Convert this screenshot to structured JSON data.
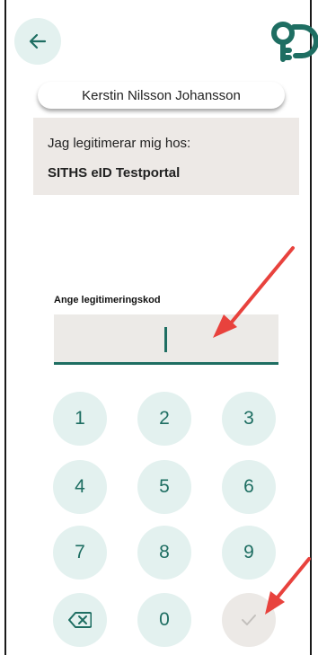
{
  "header": {
    "back_icon": "arrow-left-icon",
    "logo_icon": "key-logo-icon",
    "accent_color": "#1e6e62",
    "key_background": "#e3f1ef"
  },
  "user": {
    "name": "Kerstin Nilsson Johansson"
  },
  "info": {
    "intro": "Jag legitimerar mig hos:",
    "service": "SITHS eID Testportal"
  },
  "code_input": {
    "label": "Ange legitimeringskod",
    "value": ""
  },
  "keypad": {
    "keys": [
      "1",
      "2",
      "3",
      "4",
      "5",
      "6",
      "7",
      "8",
      "9",
      "0"
    ],
    "backspace_icon": "backspace-icon",
    "confirm_icon": "check-icon"
  },
  "annotations": {
    "arrow_color": "#e8423d"
  }
}
